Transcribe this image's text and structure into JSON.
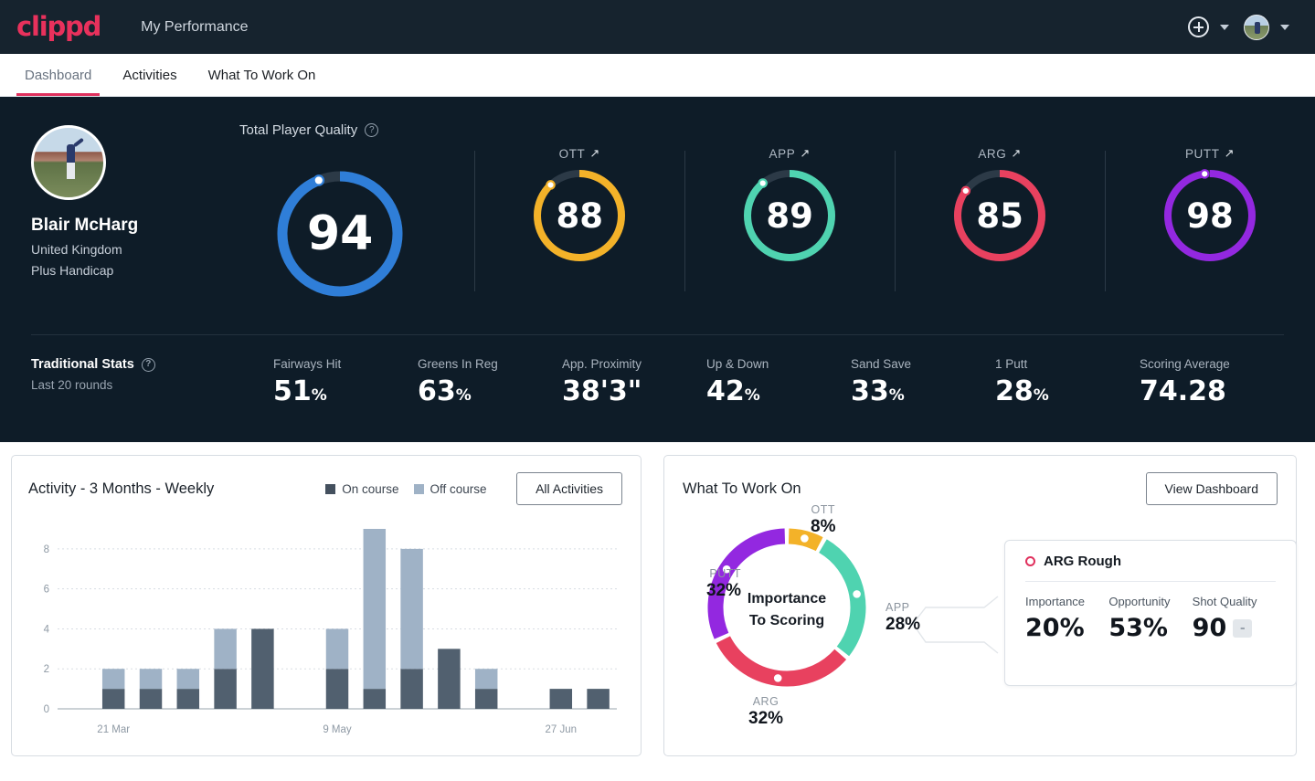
{
  "topbar": {
    "logo": "clippd",
    "nav_title": "My Performance",
    "add_icon": "plus-circle-icon",
    "avatar_icon": "user-avatar-icon"
  },
  "tabs": [
    {
      "label": "Dashboard",
      "active": true
    },
    {
      "label": "Activities",
      "active": false
    },
    {
      "label": "What To Work On",
      "active": false
    }
  ],
  "profile": {
    "name": "Blair McHarg",
    "country": "United Kingdom",
    "handicap": "Plus Handicap"
  },
  "player_quality": {
    "title": "Total Player Quality",
    "help_icon": "question-mark-icon",
    "gauges": [
      {
        "label": "",
        "value": "94",
        "color": "#2f7ed8",
        "pct": 94,
        "size": "big"
      },
      {
        "label": "OTT",
        "value": "88",
        "color": "#f3b229",
        "pct": 88,
        "trend": "↗"
      },
      {
        "label": "APP",
        "value": "89",
        "color": "#4fd3b0",
        "pct": 89,
        "trend": "↗"
      },
      {
        "label": "ARG",
        "value": "85",
        "color": "#e8415f",
        "pct": 85,
        "trend": "↗"
      },
      {
        "label": "PUTT",
        "value": "98",
        "color": "#9328e0",
        "pct": 98,
        "trend": "↗"
      }
    ]
  },
  "traditional_stats": {
    "title": "Traditional Stats",
    "help_icon": "question-mark-icon",
    "subtitle": "Last 20 rounds",
    "items": [
      {
        "label": "Fairways Hit",
        "value": "51",
        "unit": "%"
      },
      {
        "label": "Greens In Reg",
        "value": "63",
        "unit": "%"
      },
      {
        "label": "App. Proximity",
        "value": "38'3\"",
        "unit": ""
      },
      {
        "label": "Up & Down",
        "value": "42",
        "unit": "%"
      },
      {
        "label": "Sand Save",
        "value": "33",
        "unit": "%"
      },
      {
        "label": "1 Putt",
        "value": "28",
        "unit": "%"
      },
      {
        "label": "Scoring Average",
        "value": "74.28",
        "unit": ""
      }
    ]
  },
  "activity_card": {
    "title": "Activity - 3 Months - Weekly",
    "legend": [
      {
        "label": "On course",
        "color": "#44505e"
      },
      {
        "label": "Off course",
        "color": "#9fb2c6"
      }
    ],
    "button": "All Activities"
  },
  "what_to_work_on": {
    "title": "What To Work On",
    "button": "View Dashboard",
    "center_line1": "Importance",
    "center_line2": "To Scoring",
    "detail": {
      "title": "ARG Rough",
      "marker_icon": "circle-outline-icon",
      "marker_color": "#e0305d",
      "stats": [
        {
          "label": "Importance",
          "value": "20%"
        },
        {
          "label": "Opportunity",
          "value": "53%"
        },
        {
          "label": "Shot Quality",
          "value": "90",
          "badge": "-"
        }
      ]
    }
  },
  "chart_data": [
    {
      "type": "bar",
      "title": "Activity - 3 Months - Weekly",
      "stacked": true,
      "xlabel": "",
      "ylabel": "",
      "ylim": [
        0,
        9
      ],
      "yticks": [
        0,
        2,
        4,
        6,
        8
      ],
      "grid": true,
      "legend_position": "top",
      "x_tick_labels": [
        "21 Mar",
        "9 May",
        "27 Jun"
      ],
      "x_tick_index": [
        1,
        7,
        13
      ],
      "categories": [
        "w1",
        "w2",
        "w3",
        "w4",
        "w5",
        "w6",
        "w7",
        "w8",
        "w9",
        "w10",
        "w11",
        "w12",
        "w13",
        "w14",
        "w15"
      ],
      "series": [
        {
          "name": "On course",
          "color": "#51606f",
          "values": [
            0,
            1,
            1,
            1,
            2,
            4,
            0,
            2,
            1,
            2,
            3,
            1,
            0,
            1,
            1
          ]
        },
        {
          "name": "Off course",
          "color": "#9fb2c6",
          "values": [
            0,
            1,
            1,
            1,
            2,
            0,
            0,
            2,
            8,
            6,
            0,
            1,
            0,
            0,
            0
          ]
        }
      ]
    },
    {
      "type": "pie",
      "title": "Importance To Scoring",
      "donut": true,
      "labels": [
        "OTT",
        "APP",
        "ARG",
        "PUTT"
      ],
      "values": [
        8,
        28,
        32,
        32
      ],
      "value_labels": [
        "8%",
        "28%",
        "32%",
        "32%"
      ],
      "colors": [
        "#f3b229",
        "#4fd3b0",
        "#e8415f",
        "#9328e0"
      ],
      "legend_position": "around"
    }
  ]
}
